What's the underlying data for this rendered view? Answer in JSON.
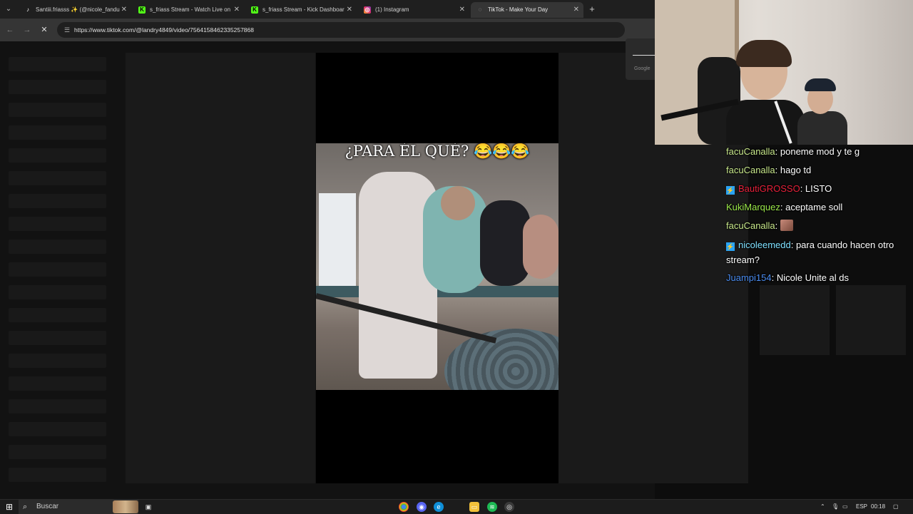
{
  "browser": {
    "tabs": [
      {
        "title": "Santiii.friasss ✨ (@nicole_fandu",
        "icon": "tiktok-icon"
      },
      {
        "title": "s_friass Stream - Watch Live on",
        "icon": "kick-icon"
      },
      {
        "title": "s_friass Stream - Kick Dashboar",
        "icon": "kick-icon"
      },
      {
        "title": "(1) Instagram",
        "icon": "instagram-icon"
      },
      {
        "title": "TikTok - Make Your Day",
        "icon": "tiktok-icon"
      }
    ],
    "url": "https://www.tiktok.com/@landry4849/video/7564158462335257868",
    "popup_label": "Google"
  },
  "video": {
    "caption": "¿PARA ÉL QUÉ? 😂😂😂"
  },
  "chat": {
    "messages": [
      {
        "user": "facuCanalla",
        "text": ": poneme mod y te g",
        "color": "#c8e88b",
        "badge": false
      },
      {
        "user": "facuCanalla",
        "text": ": hago td",
        "color": "#c8e88b",
        "badge": false
      },
      {
        "user": "BautiGROSSO",
        "text": ": LISTO",
        "color": "#e8203a",
        "badge": true
      },
      {
        "user": "KukiMarquez",
        "text": ": aceptame soll",
        "color": "#9be84a",
        "badge": false
      },
      {
        "user": "facuCanalla",
        "text": ":",
        "color": "#c8e88b",
        "badge": false,
        "emote": true
      },
      {
        "user": "nicoleemedd",
        "text": ": para cuando hacen otro stream?",
        "color": "#7ee0ff",
        "badge": true
      },
      {
        "user": "Juampi154",
        "text": ": Nicole Unite al ds",
        "color": "#4a8cf0",
        "badge": false
      }
    ]
  },
  "taskbar": {
    "search_label": "Buscar",
    "lang": "ESP",
    "time": "00:18"
  }
}
